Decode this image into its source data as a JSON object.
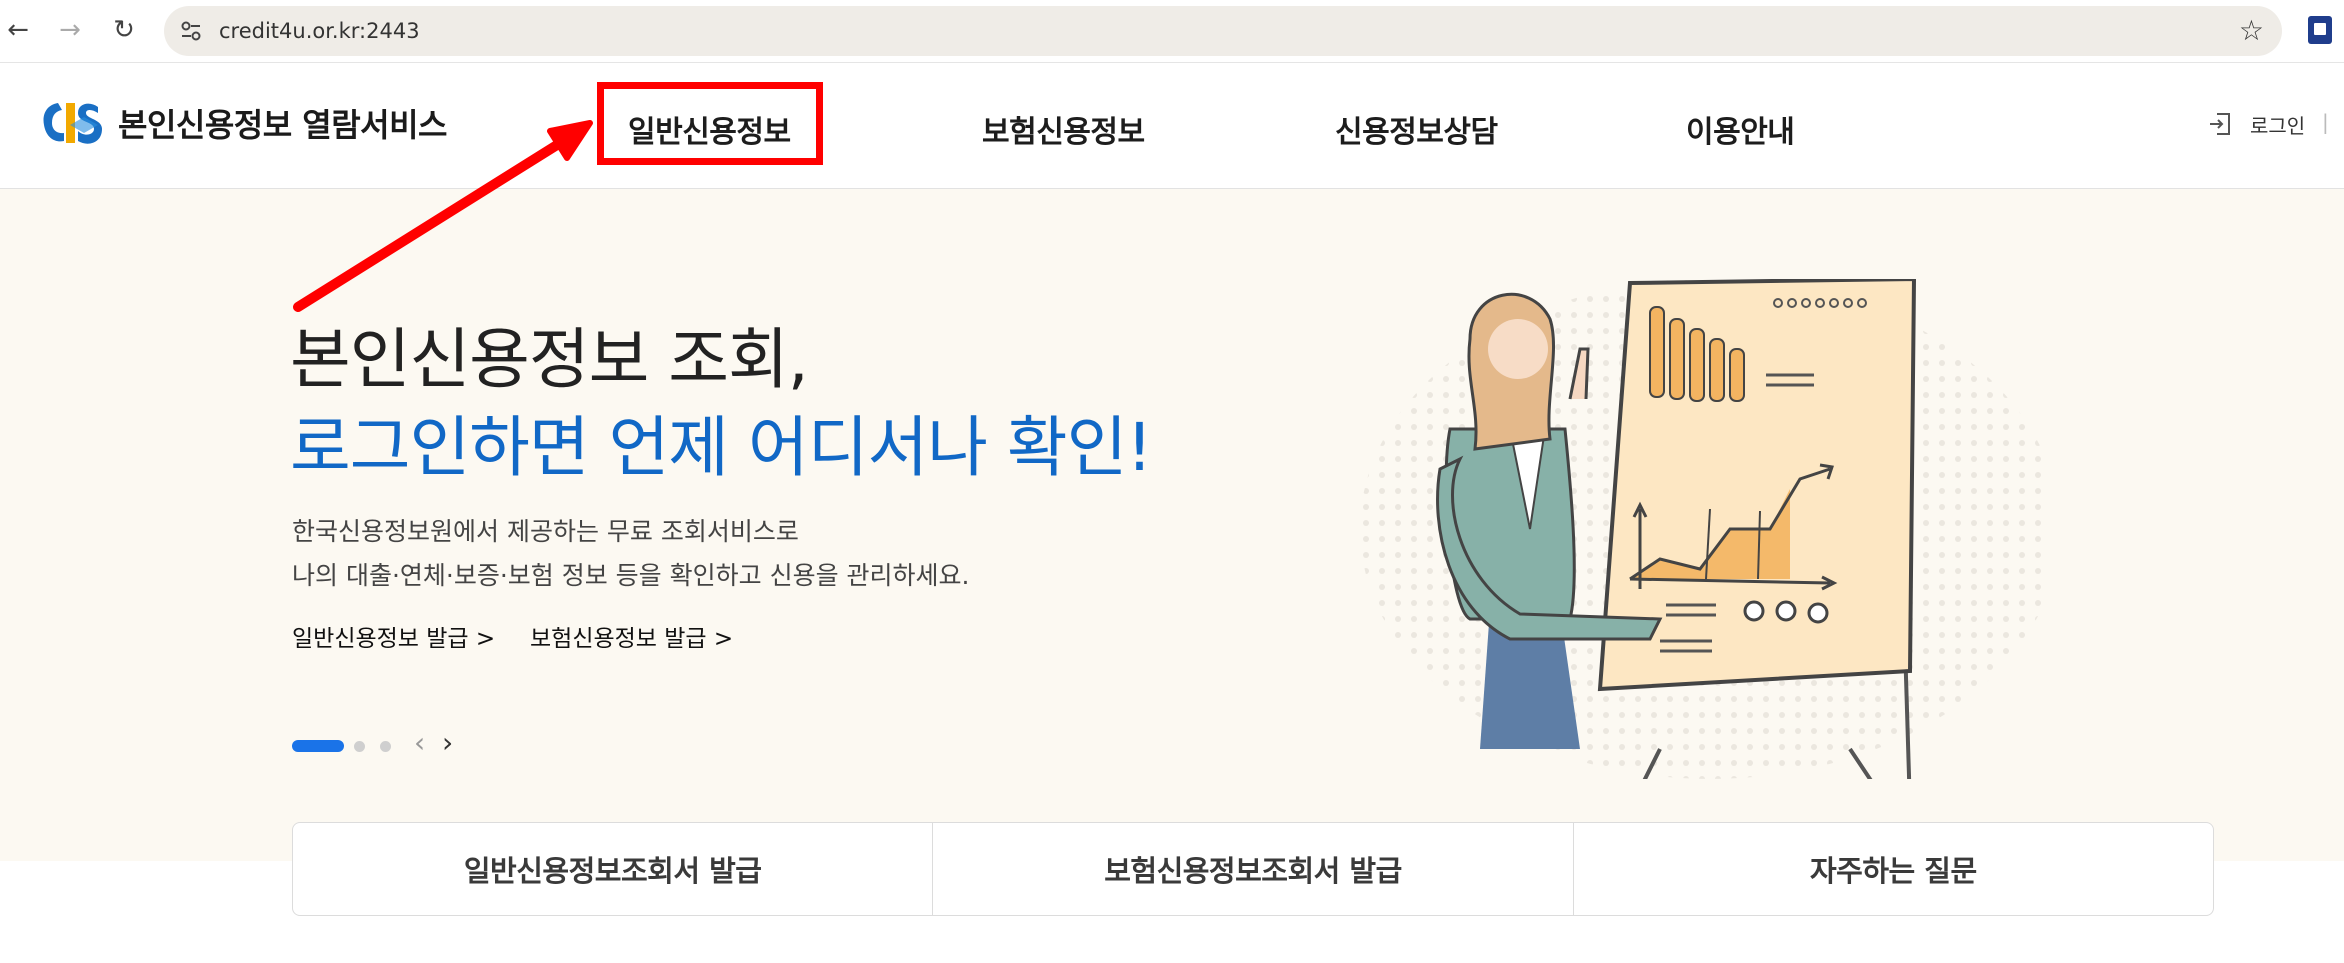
{
  "browser": {
    "url": "credit4u.or.kr:2443",
    "back_icon": "←",
    "forward_icon": "→",
    "reload_icon": "↻",
    "star_icon": "☆"
  },
  "header": {
    "brand": "본인신용정보 열람서비스",
    "nav": [
      "일반신용정보",
      "보험신용정보",
      "신용정보상담",
      "이용안내"
    ],
    "login": "로그인",
    "separator": "|"
  },
  "hero": {
    "title_line1": "본인신용정보 조회,",
    "title_line2": "로그인하면 언제 어디서나 확인!",
    "desc_line1": "한국신용정보원에서 제공하는 무료 조회서비스로",
    "desc_line2": "나의 대출·연체·보증·보험 정보 등을 확인하고 신용을 관리하세요.",
    "links": [
      "일반신용정보 발급 >",
      "보험신용정보 발급 >"
    ],
    "carousel_prev": "‹",
    "carousel_next": "›"
  },
  "quick_links": [
    "일반신용정보조회서 발급",
    "보험신용정보조회서 발급",
    "자주하는 질문"
  ],
  "colors": {
    "accent_blue": "#1168c6",
    "highlight_red": "#ff0000",
    "hero_bg": "#fcf9f2"
  }
}
